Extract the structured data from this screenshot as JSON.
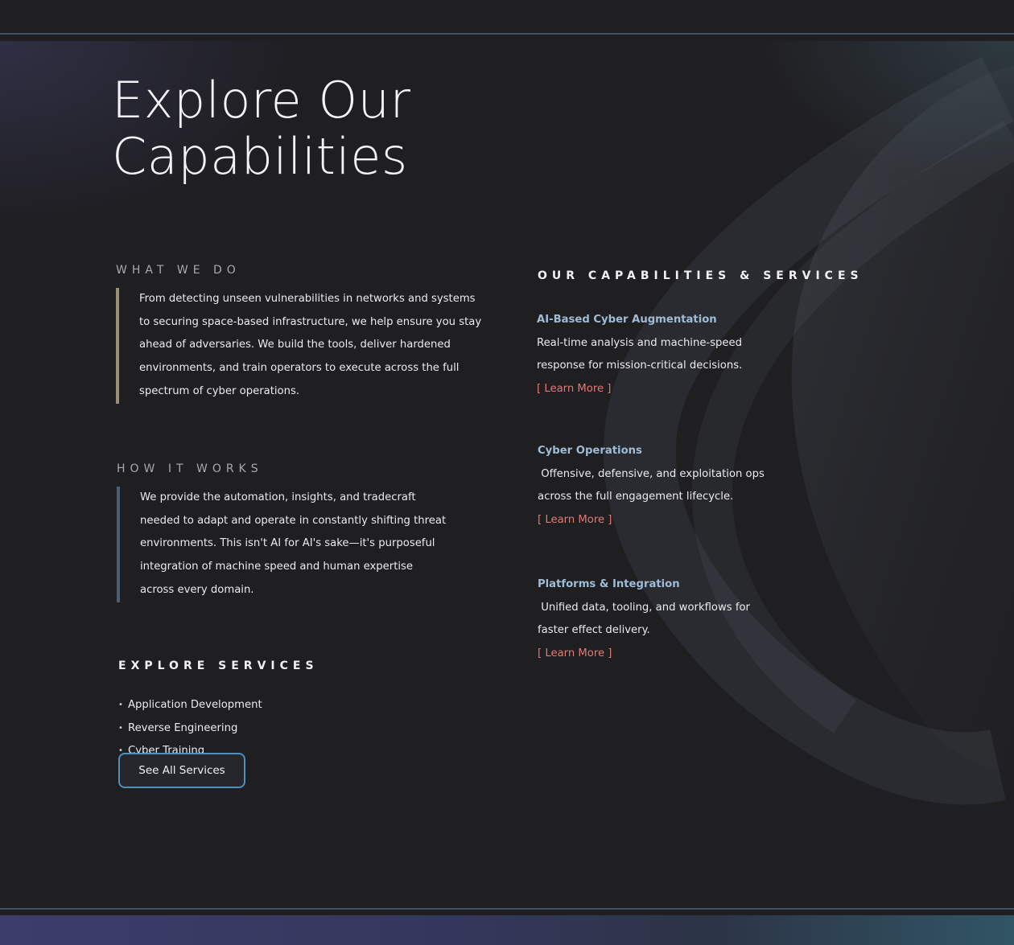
{
  "hero": {
    "title_line1": "Explore Our",
    "title_line2": "Capabilities"
  },
  "what_we_do": {
    "heading": "WHAT WE DO",
    "accent_color": "#9a8f77",
    "lines": [
      "From detecting unseen vulnerabilities in networks and systems",
      "to securing space-based infrastructure, we help ensure you stay",
      "ahead of adversaries. We build the tools, deliver hardened",
      "environments, and train operators to execute across the full",
      "spectrum of cyber operations."
    ]
  },
  "how_it_works": {
    "heading": "HOW IT WORKS",
    "accent_color": "#4a5f75",
    "lines": [
      "We provide the automation, insights, and tradecraft",
      "needed to adapt and operate in constantly shifting threat",
      "environments. This isn't AI for AI's sake—it's purposeful",
      "integration of machine speed and human expertise",
      "across every domain."
    ]
  },
  "explore_services": {
    "heading": "EXPLORE SERVICES",
    "items": [
      "Application Development",
      "Reverse Engineering",
      "Cyber Training"
    ],
    "button_label": "See All Services"
  },
  "capabilities": {
    "heading": "OUR CAPABILITIES & SERVICES",
    "items": [
      {
        "title": "AI-Based Cyber Augmentation",
        "lines": [
          "Real-time analysis and machine-speed",
          "response for mission-critical decisions."
        ],
        "link": "[ Learn More ]"
      },
      {
        "title": "Cyber Operations",
        "lines": [
          " Offensive, defensive, and exploitation ops",
          "across the full engagement lifecycle."
        ],
        "link": "[ Learn More ]"
      },
      {
        "title": "Platforms & Integration",
        "lines": [
          " Unified data, tooling, and workflows for",
          "faster effect delivery."
        ],
        "link": "[ Learn More ]"
      }
    ]
  },
  "colors": {
    "background": "#1f1e21",
    "capability_title": "#9fbcd6",
    "learn_more": "#e07b78",
    "button_border": "#4f8fb8",
    "divider": "#3f5466"
  }
}
